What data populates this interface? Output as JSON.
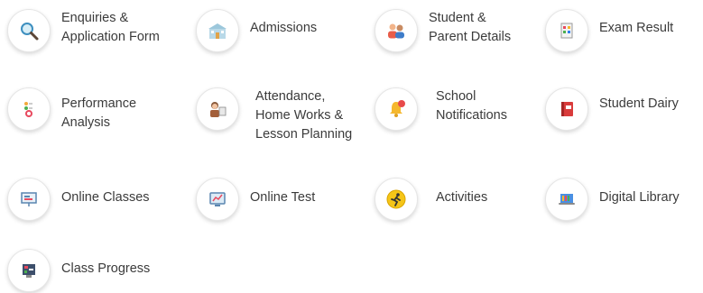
{
  "features": [
    {
      "label": "Enquiries &\nApplication Form",
      "icon": "magnifier-icon"
    },
    {
      "label": "Admissions",
      "icon": "building-icon"
    },
    {
      "label": "Student &\nParent Details",
      "icon": "people-icon"
    },
    {
      "label": "Exam Result",
      "icon": "calendar-grid-icon"
    },
    {
      "label": "Performance\nAnalysis",
      "icon": "chart-dots-icon"
    },
    {
      "label": "Attendance,\nHome Works &\nLesson Planning",
      "icon": "teacher-icon"
    },
    {
      "label": "School\nNotifications",
      "icon": "bell-icon"
    },
    {
      "label": "Student Dairy",
      "icon": "diary-icon"
    },
    {
      "label": "Online Classes",
      "icon": "presentation-icon"
    },
    {
      "label": "Online Test",
      "icon": "monitor-icon"
    },
    {
      "label": "Activities",
      "icon": "running-icon"
    },
    {
      "label": "Digital Library",
      "icon": "laptop-library-icon"
    },
    {
      "label": "Class Progress",
      "icon": "progress-board-icon"
    }
  ]
}
